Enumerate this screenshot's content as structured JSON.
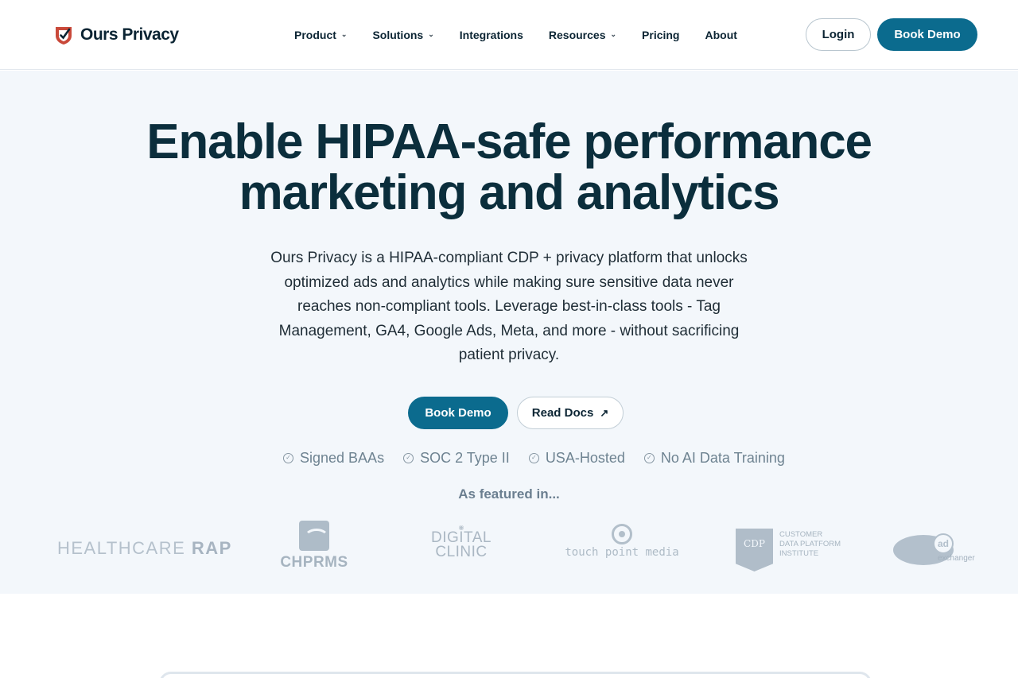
{
  "header": {
    "logo_text": "Ours Privacy",
    "nav": [
      {
        "label": "Product",
        "has_dropdown": true
      },
      {
        "label": "Solutions",
        "has_dropdown": true
      },
      {
        "label": "Integrations",
        "has_dropdown": false
      },
      {
        "label": "Resources",
        "has_dropdown": true
      },
      {
        "label": "Pricing",
        "has_dropdown": false
      },
      {
        "label": "About",
        "has_dropdown": false
      }
    ],
    "login_label": "Login",
    "book_demo_label": "Book Demo"
  },
  "hero": {
    "title_line1": "Enable HIPAA-safe performance",
    "title_line2": "marketing and analytics",
    "subtitle": "Ours Privacy is a HIPAA-compliant CDP + privacy platform that unlocks optimized ads and analytics while making sure sensitive data never reaches non-compliant tools. Leverage best-in-class tools - Tag Management, GA4, Google Ads, Meta, and more - without sacrificing patient privacy.",
    "cta_primary": "Book Demo",
    "cta_secondary": "Read Docs",
    "badges": [
      "Signed BAAs",
      "SOC 2 Type II",
      "USA-Hosted",
      "No AI Data Training"
    ],
    "featured_label": "As featured in..."
  },
  "press_logos": {
    "healthcare_rap_a": "HEALTHCARE ",
    "healthcare_rap_b": "RAP",
    "chprms": "CHPRMS",
    "digital_clinic_line1": "DIGITAL",
    "digital_clinic_line2": "CLINIC",
    "touch_point_media": "touch point media",
    "cdp_mark": "CDP",
    "cdp_line1": "CUSTOMER",
    "cdp_line2": "DATA PLATFORM",
    "cdp_line3": "INSTITUTE",
    "ad_mark": "ad",
    "ad_text": "exchanger"
  },
  "colors": {
    "brand_primary": "#0b6b8e",
    "heading": "#0b2e3c",
    "hero_bg": "#f3f7fb",
    "logo_accent": "#c9493a"
  }
}
